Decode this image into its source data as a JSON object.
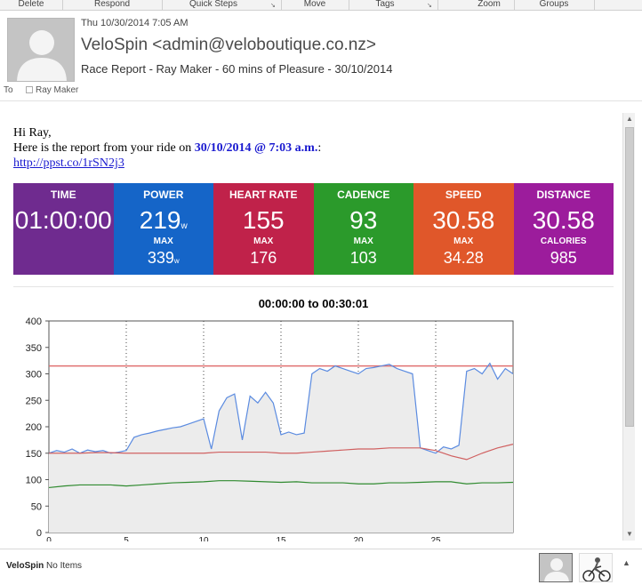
{
  "ribbon": {
    "groups": [
      "Delete",
      "Respond",
      "Quick Steps",
      "Move",
      "Tags",
      "Zoom",
      "Groups"
    ]
  },
  "message": {
    "date": "Thu 10/30/2014 7:05 AM",
    "from": "VeloSpin <admin@veloboutique.co.nz>",
    "subject": "Race Report - Ray Maker - 60 mins of Pleasure - 30/10/2014",
    "to_label": "To",
    "to": "Ray Maker"
  },
  "body": {
    "greeting": "Hi Ray,",
    "intro": "Here is the report from your ride on",
    "ride_date": "30/10/2014 @ 7:03 a.m.",
    "intro_end": ":",
    "link": "http://ppst.co/1rSN2j3"
  },
  "tiles": [
    {
      "label": "TIME",
      "value": "01:00:00",
      "unit": "",
      "sub_label": "",
      "sub_value": "",
      "sub_unit": "",
      "color": "#6f2b8f"
    },
    {
      "label": "POWER",
      "value": "219",
      "unit": "w",
      "sub_label": "MAX",
      "sub_value": "339",
      "sub_unit": "w",
      "color": "#1565c8"
    },
    {
      "label": "HEART RATE",
      "value": "155",
      "unit": "",
      "sub_label": "MAX",
      "sub_value": "176",
      "sub_unit": "",
      "color": "#c0224a"
    },
    {
      "label": "CADENCE",
      "value": "93",
      "unit": "",
      "sub_label": "MAX",
      "sub_value": "103",
      "sub_unit": "",
      "color": "#2b9a2b"
    },
    {
      "label": "SPEED",
      "value": "30.58",
      "unit": "",
      "sub_label": "MAX",
      "sub_value": "34.28",
      "sub_unit": "",
      "color": "#e0572a"
    },
    {
      "label": "DISTANCE",
      "value": "30.58",
      "unit": "",
      "sub_label": "CALORIES",
      "sub_value": "985",
      "sub_unit": "",
      "color": "#9c1c9c"
    }
  ],
  "chart_data": {
    "type": "line",
    "title": "00:00:00 to 00:30:01",
    "xlabel": "",
    "ylabel": "",
    "ylim": [
      0,
      400
    ],
    "xlim": [
      0,
      30
    ],
    "yticks": [
      "0",
      "50",
      "100",
      "150",
      "200",
      "250",
      "300",
      "350",
      "400"
    ],
    "xticks": [
      "0",
      "5",
      "10",
      "15",
      "20",
      "25"
    ],
    "vgrid_dotted": [
      5,
      10,
      15,
      20,
      25
    ],
    "grid": "vertical dotted",
    "colors": {
      "power": "#5b8be0",
      "heart_rate": "#d06060",
      "cadence": "#2f8a2f",
      "max_line": "#e07070",
      "fill": "#ececec"
    },
    "series": [
      {
        "key": "power",
        "x": [
          0,
          0.5,
          1,
          1.5,
          2,
          2.5,
          3,
          3.5,
          4,
          4.5,
          5,
          5.5,
          6,
          6.5,
          7,
          7.5,
          8,
          8.5,
          9,
          9.5,
          10,
          10.5,
          11,
          11.5,
          12,
          12.5,
          13,
          13.5,
          14,
          14.5,
          15,
          15.5,
          16,
          16.5,
          17,
          17.5,
          18,
          18.5,
          19,
          19.5,
          20,
          20.5,
          21,
          21.5,
          22,
          22.5,
          23,
          23.5,
          24,
          24.5,
          25,
          25.5,
          26,
          26.5,
          27,
          27.5,
          28,
          28.5,
          29,
          29.5,
          30
        ],
        "values": [
          150,
          155,
          152,
          158,
          150,
          156,
          153,
          155,
          150,
          152,
          155,
          180,
          185,
          188,
          192,
          195,
          198,
          200,
          205,
          210,
          215,
          158,
          230,
          255,
          262,
          175,
          258,
          245,
          265,
          245,
          185,
          190,
          185,
          188,
          300,
          310,
          305,
          315,
          310,
          305,
          300,
          310,
          312,
          315,
          318,
          310,
          305,
          300,
          160,
          155,
          150,
          162,
          158,
          165,
          305,
          310,
          300,
          320,
          290,
          310,
          300
        ]
      },
      {
        "key": "heart_rate",
        "x": [
          0,
          1,
          2,
          3,
          4,
          5,
          6,
          7,
          8,
          9,
          10,
          11,
          12,
          13,
          14,
          15,
          16,
          17,
          18,
          19,
          20,
          21,
          22,
          23,
          24,
          25,
          26,
          27,
          28,
          29,
          30
        ],
        "values": [
          150,
          150,
          150,
          151,
          151,
          150,
          150,
          150,
          150,
          150,
          150,
          152,
          152,
          152,
          152,
          150,
          150,
          152,
          154,
          156,
          158,
          158,
          160,
          160,
          160,
          155,
          145,
          138,
          150,
          160,
          167
        ]
      },
      {
        "key": "cadence",
        "x": [
          0,
          1,
          2,
          3,
          4,
          5,
          6,
          7,
          8,
          9,
          10,
          11,
          12,
          13,
          14,
          15,
          16,
          17,
          18,
          19,
          20,
          21,
          22,
          23,
          24,
          25,
          26,
          27,
          28,
          29,
          30
        ],
        "values": [
          85,
          88,
          90,
          90,
          90,
          88,
          90,
          92,
          94,
          95,
          96,
          98,
          98,
          97,
          96,
          95,
          96,
          94,
          94,
          94,
          92,
          92,
          94,
          94,
          95,
          96,
          96,
          92,
          94,
          94,
          95
        ]
      },
      {
        "key": "max_line",
        "x": [
          0,
          30
        ],
        "values": [
          315,
          315
        ]
      }
    ]
  },
  "footer": {
    "name": "VeloSpin",
    "status": "No Items"
  }
}
